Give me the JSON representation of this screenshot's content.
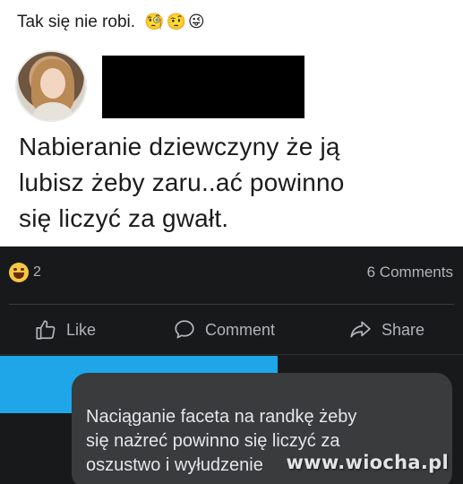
{
  "caption": {
    "text": "Tak się nie robi.",
    "emojis": [
      "🧐",
      "🤨",
      "😜"
    ]
  },
  "post": {
    "lines": [
      "Nabieranie dziewczyny że ją",
      "lubisz żeby zaru..ać powinno",
      "się liczyć za gwałt."
    ]
  },
  "reactions": {
    "icon": "laugh-reaction-icon",
    "count": "2",
    "comments": "6 Comments"
  },
  "actions": {
    "like": "Like",
    "comment": "Comment",
    "share": "Share"
  },
  "comment": {
    "lines": [
      "Naciąganie faceta na randkę żeby",
      "się nażreć powinno się liczyć za",
      "oszustwo i wyłudzenie"
    ]
  },
  "watermark": "www.wiocha.pl",
  "colors": {
    "dark_background": "#18191a",
    "bubble": "#3a3b3c",
    "blue_bar": "#1ea6e8",
    "muted_text": "#b0b3b8"
  }
}
